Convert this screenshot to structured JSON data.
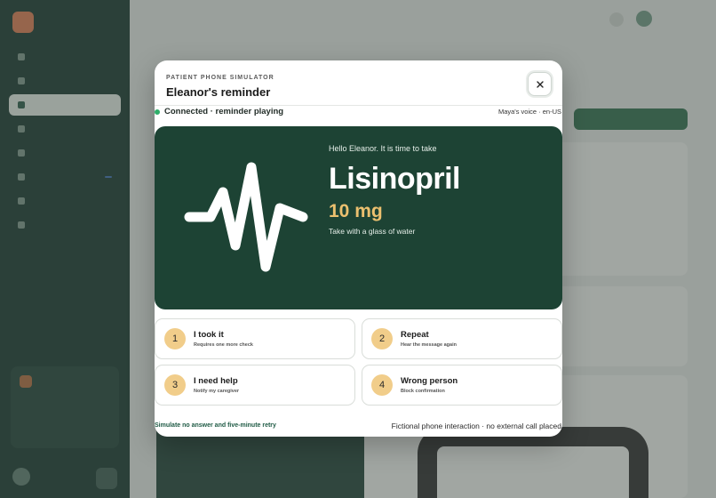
{
  "modal": {
    "eyebrow": "PATIENT PHONE SIMULATOR",
    "title": "Eleanor's reminder",
    "status": "Connected · reminder playing",
    "voice": "Maya's voice · en-US",
    "close_icon": "close-icon"
  },
  "screen": {
    "greeting": "Hello Eleanor. It is time to take",
    "medication": "Lisinopril",
    "dose": "10 mg",
    "instruction": "Take with a glass of water",
    "icon": "pulse-icon"
  },
  "options": [
    {
      "number": "1",
      "title": "I took it",
      "subtitle": "Requires one more check"
    },
    {
      "number": "2",
      "title": "Repeat",
      "subtitle": "Hear the message again"
    },
    {
      "number": "3",
      "title": "I need help",
      "subtitle": "Notify my caregiver"
    },
    {
      "number": "4",
      "title": "Wrong person",
      "subtitle": "Block confirmation"
    }
  ],
  "footer": {
    "link": "Simulate no answer and five-minute retry",
    "note": "Fictional phone interaction · no external call placed"
  },
  "colors": {
    "screen_bg": "#1d4334",
    "dose": "#ecc06f",
    "badge": "#f1cd8a",
    "status_dot": "#2fae6a"
  }
}
